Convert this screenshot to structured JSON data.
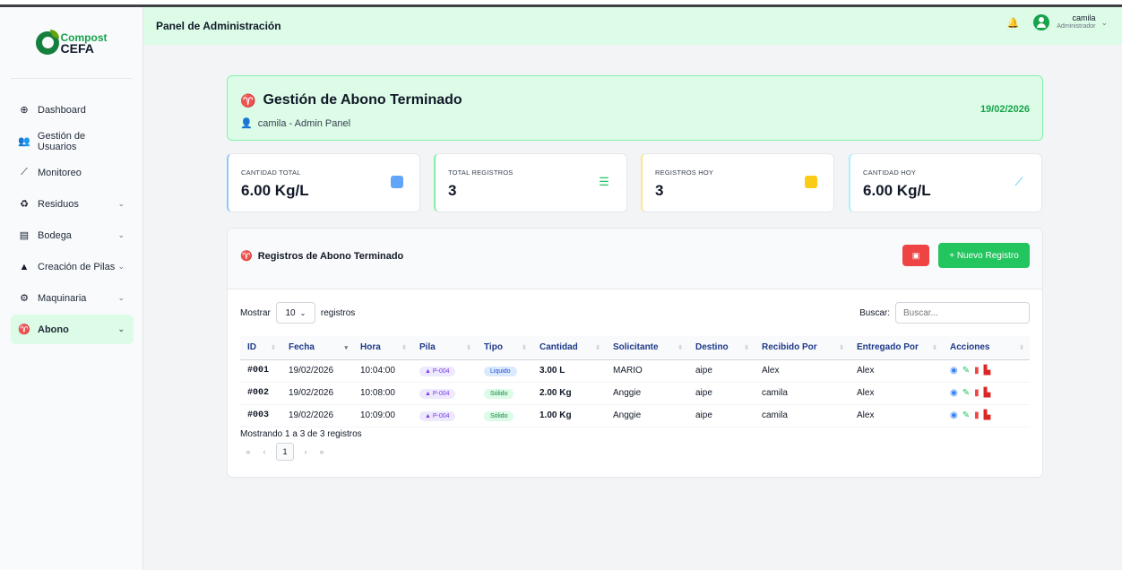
{
  "brand": {
    "line1": "Compost",
    "line2": "CEFA"
  },
  "header": {
    "title": "Panel de Administración",
    "user_name": "camila",
    "user_role": "Administrador"
  },
  "sidebar": {
    "items": [
      {
        "label": "Dashboard",
        "icon": "globe-icon"
      },
      {
        "label": "Gestión de Usuarios",
        "icon": "users-icon"
      },
      {
        "label": "Monitoreo",
        "icon": "chart-line-icon"
      },
      {
        "label": "Residuos",
        "icon": "recycle-icon"
      },
      {
        "label": "Bodega",
        "icon": "warehouse-icon"
      },
      {
        "label": "Creación de Pilas",
        "icon": "mountain-icon"
      },
      {
        "label": "Maquinaria",
        "icon": "gears-icon"
      },
      {
        "label": "Abono",
        "icon": "seedling-icon"
      }
    ]
  },
  "banner": {
    "title": "Gestión de Abono Terminado",
    "subtitle": "camila - Admin Panel",
    "date": "19/02/2026"
  },
  "stats": [
    {
      "label": "CANTIDAD TOTAL",
      "value": "6.00 Kg/L",
      "color": "#3b82f6"
    },
    {
      "label": "TOTAL REGISTROS",
      "value": "3",
      "color": "#22c55e"
    },
    {
      "label": "REGISTROS HOY",
      "value": "3",
      "color": "#facc15"
    },
    {
      "label": "CANTIDAD HOY",
      "value": "6.00 Kg/L",
      "color": "#38bdf8"
    }
  ],
  "records": {
    "title": "Registros de Abono Terminado",
    "new_button": "+ Nuevo Registro",
    "show_label": "Mostrar",
    "page_size": "10",
    "records_label": "registros",
    "search_label": "Buscar:",
    "search_placeholder": "Buscar...",
    "columns": [
      "ID",
      "Fecha",
      "Hora",
      "Pila",
      "Tipo",
      "Cantidad",
      "Solicitante",
      "Destino",
      "Recibido Por",
      "Entregado Por",
      "Acciones"
    ],
    "rows": [
      {
        "id": "#001",
        "fecha": "19/02/2026",
        "hora": "10:04:00",
        "pila": "P-004",
        "tipo": "Liquido",
        "cantidad": "3.00 L",
        "solicitante": "MARIO",
        "destino": "aipe",
        "recibido": "Alex",
        "entregado": "Alex"
      },
      {
        "id": "#002",
        "fecha": "19/02/2026",
        "hora": "10:08:00",
        "pila": "P-004",
        "tipo": "Sólido",
        "cantidad": "2.00 Kg",
        "solicitante": "Anggie",
        "destino": "aipe",
        "recibido": "camila",
        "entregado": "Alex"
      },
      {
        "id": "#003",
        "fecha": "19/02/2026",
        "hora": "10:09:00",
        "pila": "P-004",
        "tipo": "Sólido",
        "cantidad": "1.00 Kg",
        "solicitante": "Anggie",
        "destino": "aipe",
        "recibido": "camila",
        "entregado": "Alex"
      }
    ],
    "info": "Mostrando 1 a 3 de 3 registros",
    "pagination": {
      "first": "«",
      "prev": "‹",
      "current": "1",
      "next": "›",
      "last": "»"
    }
  }
}
